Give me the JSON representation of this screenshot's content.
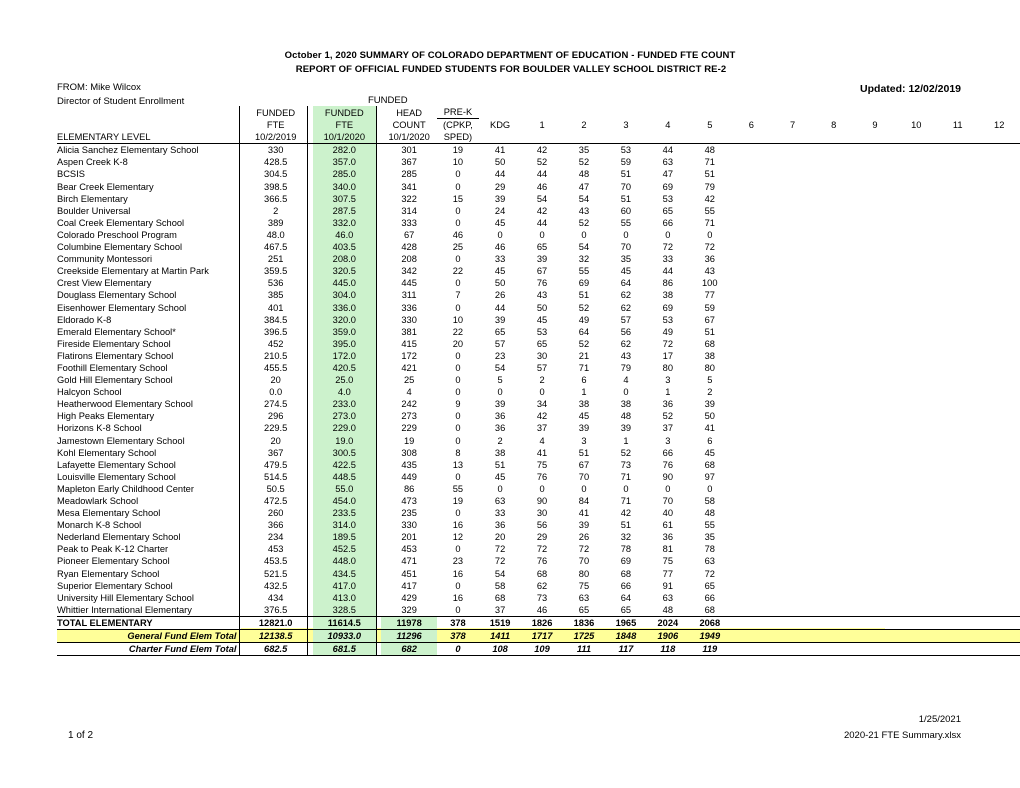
{
  "document": {
    "title_line_1": "October 1, 2020 SUMMARY OF COLORADO DEPARTMENT OF EDUCATION - FUNDED FTE COUNT",
    "title_line_2": "REPORT OF OFFICIAL FUNDED STUDENTS FOR BOULDER VALLEY SCHOOL DISTRICT RE-2",
    "from": "FROM: Mike Wilcox",
    "from_title": "Director of Student Enrollment",
    "updated": "Updated: 12/02/2019",
    "funded_label": "FUNDED"
  },
  "colors": {
    "green_highlight": "#ccf2cc",
    "yellow_highlight": "#ffff99",
    "text": "#000000"
  },
  "table": {
    "section_label": "ELEMENTARY LEVEL",
    "headers": {
      "fte_2019": [
        "FUNDED",
        "FTE",
        "10/2/2019"
      ],
      "fte_2020": [
        "FUNDED",
        "FTE",
        "10/1/2020"
      ],
      "head_count": [
        "HEAD",
        "COUNT",
        "10/1/2020"
      ],
      "pre_k": [
        "PRE-K",
        "(CPKP,",
        "SPED)"
      ],
      "grades": [
        "KDG",
        "1",
        "2",
        "3",
        "4",
        "5",
        "6",
        "7",
        "8",
        "9",
        "10",
        "11",
        "12"
      ]
    },
    "rows": [
      {
        "name": "Alicia Sanchez Elementary School",
        "fte19": "330",
        "fte20": "282.0",
        "head": "301",
        "prek": "19",
        "grades": [
          "41",
          "42",
          "35",
          "53",
          "44",
          "48",
          "",
          "",
          "",
          "",
          "",
          "",
          ""
        ]
      },
      {
        "name": "Aspen Creek K-8",
        "fte19": "428.5",
        "fte20": "357.0",
        "head": "367",
        "prek": "10",
        "grades": [
          "50",
          "52",
          "52",
          "59",
          "63",
          "71",
          "",
          "",
          "",
          "",
          "",
          "",
          ""
        ]
      },
      {
        "name": "BCSIS",
        "fte19": "304.5",
        "fte20": "285.0",
        "head": "285",
        "prek": "0",
        "grades": [
          "44",
          "44",
          "48",
          "51",
          "47",
          "51",
          "",
          "",
          "",
          "",
          "",
          "",
          ""
        ]
      },
      {
        "name": "Bear Creek Elementary",
        "fte19": "398.5",
        "fte20": "340.0",
        "head": "341",
        "prek": "0",
        "grades": [
          "29",
          "46",
          "47",
          "70",
          "69",
          "79",
          "",
          "",
          "",
          "",
          "",
          "",
          ""
        ]
      },
      {
        "name": "Birch Elementary",
        "fte19": "366.5",
        "fte20": "307.5",
        "head": "322",
        "prek": "15",
        "grades": [
          "39",
          "54",
          "54",
          "51",
          "53",
          "42",
          "",
          "",
          "",
          "",
          "",
          "",
          ""
        ]
      },
      {
        "name": "Boulder Universal",
        "fte19": "2",
        "fte20": "287.5",
        "head": "314",
        "prek": "0",
        "grades": [
          "24",
          "42",
          "43",
          "60",
          "65",
          "55",
          "",
          "",
          "",
          "",
          "",
          "",
          ""
        ]
      },
      {
        "name": "Coal Creek Elementary School",
        "fte19": "389",
        "fte20": "332.0",
        "head": "333",
        "prek": "0",
        "grades": [
          "45",
          "44",
          "52",
          "55",
          "66",
          "71",
          "",
          "",
          "",
          "",
          "",
          "",
          ""
        ]
      },
      {
        "name": "Colorado Preschool Program",
        "fte19": "48.0",
        "fte20": "46.0",
        "head": "67",
        "prek": "46",
        "grades": [
          "0",
          "0",
          "0",
          "0",
          "0",
          "0",
          "",
          "",
          "",
          "",
          "",
          "",
          ""
        ]
      },
      {
        "name": "Columbine Elementary School",
        "fte19": "467.5",
        "fte20": "403.5",
        "head": "428",
        "prek": "25",
        "grades": [
          "46",
          "65",
          "54",
          "70",
          "72",
          "72",
          "",
          "",
          "",
          "",
          "",
          "",
          ""
        ]
      },
      {
        "name": "Community Montessori",
        "fte19": "251",
        "fte20": "208.0",
        "head": "208",
        "prek": "0",
        "grades": [
          "33",
          "39",
          "32",
          "35",
          "33",
          "36",
          "",
          "",
          "",
          "",
          "",
          "",
          ""
        ]
      },
      {
        "name": "Creekside Elementary at Martin Park",
        "fte19": "359.5",
        "fte20": "320.5",
        "head": "342",
        "prek": "22",
        "grades": [
          "45",
          "67",
          "55",
          "45",
          "44",
          "43",
          "",
          "",
          "",
          "",
          "",
          "",
          ""
        ]
      },
      {
        "name": "Crest View Elementary",
        "fte19": "536",
        "fte20": "445.0",
        "head": "445",
        "prek": "0",
        "grades": [
          "50",
          "76",
          "69",
          "64",
          "86",
          "100",
          "",
          "",
          "",
          "",
          "",
          "",
          ""
        ]
      },
      {
        "name": "Douglass Elementary School",
        "fte19": "385",
        "fte20": "304.0",
        "head": "311",
        "prek": "7",
        "grades": [
          "26",
          "43",
          "51",
          "62",
          "38",
          "77",
          "",
          "",
          "",
          "",
          "",
          "",
          ""
        ]
      },
      {
        "name": "Eisenhower Elementary School",
        "fte19": "401",
        "fte20": "336.0",
        "head": "336",
        "prek": "0",
        "grades": [
          "44",
          "50",
          "52",
          "62",
          "69",
          "59",
          "",
          "",
          "",
          "",
          "",
          "",
          ""
        ]
      },
      {
        "name": "Eldorado K-8",
        "fte19": "384.5",
        "fte20": "320.0",
        "head": "330",
        "prek": "10",
        "grades": [
          "39",
          "45",
          "49",
          "57",
          "53",
          "67",
          "",
          "",
          "",
          "",
          "",
          "",
          ""
        ]
      },
      {
        "name": "Emerald Elementary School*",
        "fte19": "396.5",
        "fte20": "359.0",
        "head": "381",
        "prek": "22",
        "grades": [
          "65",
          "53",
          "64",
          "56",
          "49",
          "51",
          "",
          "",
          "",
          "",
          "",
          "",
          ""
        ]
      },
      {
        "name": "Fireside Elementary School",
        "fte19": "452",
        "fte20": "395.0",
        "head": "415",
        "prek": "20",
        "grades": [
          "57",
          "65",
          "52",
          "62",
          "72",
          "68",
          "",
          "",
          "",
          "",
          "",
          "",
          ""
        ]
      },
      {
        "name": "Flatirons Elementary School",
        "fte19": "210.5",
        "fte20": "172.0",
        "head": "172",
        "prek": "0",
        "grades": [
          "23",
          "30",
          "21",
          "43",
          "17",
          "38",
          "",
          "",
          "",
          "",
          "",
          "",
          ""
        ]
      },
      {
        "name": "Foothill Elementary School",
        "fte19": "455.5",
        "fte20": "420.5",
        "head": "421",
        "prek": "0",
        "grades": [
          "54",
          "57",
          "71",
          "79",
          "80",
          "80",
          "",
          "",
          "",
          "",
          "",
          "",
          ""
        ]
      },
      {
        "name": "Gold Hill Elementary School",
        "fte19": "20",
        "fte20": "25.0",
        "head": "25",
        "prek": "0",
        "grades": [
          "5",
          "2",
          "6",
          "4",
          "3",
          "5",
          "",
          "",
          "",
          "",
          "",
          "",
          ""
        ]
      },
      {
        "name": "Halcyon School",
        "fte19": "0.0",
        "fte20": "4.0",
        "head": "4",
        "prek": "0",
        "grades": [
          "0",
          "0",
          "1",
          "0",
          "1",
          "2",
          "",
          "",
          "",
          "",
          "",
          "",
          ""
        ]
      },
      {
        "name": "Heatherwood Elementary School",
        "fte19": "274.5",
        "fte20": "233.0",
        "head": "242",
        "prek": "9",
        "grades": [
          "39",
          "34",
          "38",
          "38",
          "36",
          "39",
          "",
          "",
          "",
          "",
          "",
          "",
          ""
        ]
      },
      {
        "name": "High Peaks Elementary",
        "fte19": "296",
        "fte20": "273.0",
        "head": "273",
        "prek": "0",
        "grades": [
          "36",
          "42",
          "45",
          "48",
          "52",
          "50",
          "",
          "",
          "",
          "",
          "",
          "",
          ""
        ]
      },
      {
        "name": "Horizons K-8 School",
        "fte19": "229.5",
        "fte20": "229.0",
        "head": "229",
        "prek": "0",
        "grades": [
          "36",
          "37",
          "39",
          "39",
          "37",
          "41",
          "",
          "",
          "",
          "",
          "",
          "",
          ""
        ]
      },
      {
        "name": "Jamestown Elementary School",
        "fte19": "20",
        "fte20": "19.0",
        "head": "19",
        "prek": "0",
        "grades": [
          "2",
          "4",
          "3",
          "1",
          "3",
          "6",
          "",
          "",
          "",
          "",
          "",
          "",
          ""
        ]
      },
      {
        "name": "Kohl Elementary School",
        "fte19": "367",
        "fte20": "300.5",
        "head": "308",
        "prek": "8",
        "grades": [
          "38",
          "41",
          "51",
          "52",
          "66",
          "45",
          "",
          "",
          "",
          "",
          "",
          "",
          ""
        ]
      },
      {
        "name": "Lafayette Elementary School",
        "fte19": "479.5",
        "fte20": "422.5",
        "head": "435",
        "prek": "13",
        "grades": [
          "51",
          "75",
          "67",
          "73",
          "76",
          "68",
          "",
          "",
          "",
          "",
          "",
          "",
          ""
        ]
      },
      {
        "name": "Louisville Elementary School",
        "fte19": "514.5",
        "fte20": "448.5",
        "head": "449",
        "prek": "0",
        "grades": [
          "45",
          "76",
          "70",
          "71",
          "90",
          "97",
          "",
          "",
          "",
          "",
          "",
          "",
          ""
        ]
      },
      {
        "name": "Mapleton Early Childhood Center",
        "fte19": "50.5",
        "fte20": "55.0",
        "head": "86",
        "prek": "55",
        "grades": [
          "0",
          "0",
          "0",
          "0",
          "0",
          "0",
          "",
          "",
          "",
          "",
          "",
          "",
          ""
        ]
      },
      {
        "name": "Meadowlark School",
        "fte19": "472.5",
        "fte20": "454.0",
        "head": "473",
        "prek": "19",
        "grades": [
          "63",
          "90",
          "84",
          "71",
          "70",
          "58",
          "",
          "",
          "",
          "",
          "",
          "",
          ""
        ]
      },
      {
        "name": "Mesa Elementary School",
        "fte19": "260",
        "fte20": "233.5",
        "head": "235",
        "prek": "0",
        "grades": [
          "33",
          "30",
          "41",
          "42",
          "40",
          "48",
          "",
          "",
          "",
          "",
          "",
          "",
          ""
        ]
      },
      {
        "name": "Monarch K-8 School",
        "fte19": "366",
        "fte20": "314.0",
        "head": "330",
        "prek": "16",
        "grades": [
          "36",
          "56",
          "39",
          "51",
          "61",
          "55",
          "",
          "",
          "",
          "",
          "",
          "",
          ""
        ]
      },
      {
        "name": "Nederland Elementary School",
        "fte19": "234",
        "fte20": "189.5",
        "head": "201",
        "prek": "12",
        "grades": [
          "20",
          "29",
          "26",
          "32",
          "36",
          "35",
          "",
          "",
          "",
          "",
          "",
          "",
          ""
        ]
      },
      {
        "name": "Peak to Peak K-12 Charter",
        "fte19": "453",
        "fte20": "452.5",
        "head": "453",
        "prek": "0",
        "grades": [
          "72",
          "72",
          "72",
          "78",
          "81",
          "78",
          "",
          "",
          "",
          "",
          "",
          "",
          ""
        ]
      },
      {
        "name": "Pioneer Elementary School",
        "fte19": "453.5",
        "fte20": "448.0",
        "head": "471",
        "prek": "23",
        "grades": [
          "72",
          "76",
          "70",
          "69",
          "75",
          "63",
          "",
          "",
          "",
          "",
          "",
          "",
          ""
        ]
      },
      {
        "name": "Ryan Elementary School",
        "fte19": "521.5",
        "fte20": "434.5",
        "head": "451",
        "prek": "16",
        "grades": [
          "54",
          "68",
          "80",
          "68",
          "77",
          "72",
          "",
          "",
          "",
          "",
          "",
          "",
          ""
        ]
      },
      {
        "name": "Superior Elementary School",
        "fte19": "432.5",
        "fte20": "417.0",
        "head": "417",
        "prek": "0",
        "grades": [
          "58",
          "62",
          "75",
          "66",
          "91",
          "65",
          "",
          "",
          "",
          "",
          "",
          "",
          ""
        ]
      },
      {
        "name": "University Hill Elementary School",
        "fte19": "434",
        "fte20": "413.0",
        "head": "429",
        "prek": "16",
        "grades": [
          "68",
          "73",
          "63",
          "64",
          "63",
          "66",
          "",
          "",
          "",
          "",
          "",
          "",
          ""
        ]
      },
      {
        "name": "Whittier International Elementary",
        "fte19": "376.5",
        "fte20": "328.5",
        "head": "329",
        "prek": "0",
        "grades": [
          "37",
          "46",
          "65",
          "65",
          "48",
          "68",
          "",
          "",
          "",
          "",
          "",
          "",
          ""
        ]
      }
    ],
    "totals": [
      {
        "name": "TOTAL ELEMENTARY",
        "fte19": "12821.0",
        "fte20": "11614.5",
        "head": "11978",
        "prek": "378",
        "grades": [
          "1519",
          "1826",
          "1836",
          "1965",
          "2024",
          "2068",
          "",
          "",
          "",
          "",
          "",
          "",
          ""
        ]
      },
      {
        "name": "General Fund Elem Total",
        "fte19": "12138.5",
        "fte20": "10933.0",
        "head": "11296",
        "prek": "378",
        "grades": [
          "1411",
          "1717",
          "1725",
          "1848",
          "1906",
          "1949",
          "",
          "",
          "",
          "",
          "",
          "",
          ""
        ]
      },
      {
        "name": "Charter Fund Elem Total",
        "fte19": "682.5",
        "fte20": "681.5",
        "head": "682",
        "prek": "0",
        "grades": [
          "108",
          "109",
          "111",
          "117",
          "118",
          "119",
          "",
          "",
          "",
          "",
          "",
          "",
          ""
        ]
      }
    ]
  },
  "footer": {
    "date": "1/25/2021",
    "filename": "2020-21 FTE Summary.xlsx",
    "page": "1 of 2"
  }
}
